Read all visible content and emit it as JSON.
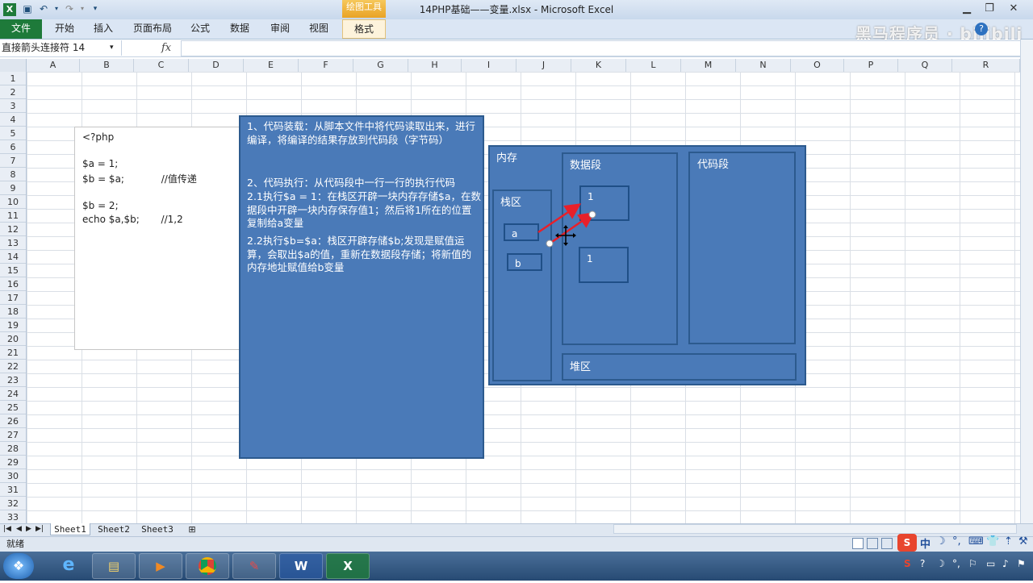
{
  "window": {
    "title": "14PHP基础——变量.xlsx  -  Microsoft Excel",
    "context_tab": "绘图工具",
    "watermark": "黑马程序员 · bilibili"
  },
  "ribbon": {
    "tabs": [
      "开始",
      "插入",
      "页面布局",
      "公式",
      "数据",
      "审阅",
      "视图"
    ],
    "file_tab": "文件",
    "format_tab": "格式"
  },
  "formula_bar": {
    "name_box": "直接箭头连接符 14",
    "fx_label": "fx",
    "value": ""
  },
  "grid": {
    "columns": [
      "A",
      "B",
      "C",
      "D",
      "E",
      "F",
      "G",
      "H",
      "I",
      "J",
      "K",
      "L",
      "M",
      "N",
      "O",
      "P",
      "Q",
      "R"
    ],
    "rows": [
      "1",
      "2",
      "3",
      "4",
      "5",
      "6",
      "7",
      "8",
      "9",
      "10",
      "11",
      "12",
      "13",
      "14",
      "15",
      "16",
      "17",
      "18",
      "19",
      "20",
      "21",
      "22",
      "23",
      "24",
      "25",
      "26",
      "27",
      "28",
      "29",
      "30",
      "31",
      "32",
      "33"
    ]
  },
  "code_box": {
    "lines": [
      "<?php",
      "",
      "$a = 1;",
      "$b = $a;            //值传递",
      "",
      "$b = 2;",
      "echo $a,$b;       //1,2"
    ]
  },
  "note_box": {
    "p1": "1、代码装载：从脚本文件中将代码读取出来，进行编译，将编译的结果存放到代码段（字节码）",
    "p2": "2、代码执行：从代码段中一行一行的执行代码",
    "p3": "2.1执行$a = 1：在栈区开辟一块内存存储$a，在数据段中开辟一块内存保存值1；然后将1所在的位置复制给a变量",
    "p4": "2.2执行$b=$a：栈区开辟存储$b;发现是赋值运算，会取出$a的值，重新在数据段存储；将新值的内存地址赋值给b变量"
  },
  "memory_diagram": {
    "memory_label": "内存",
    "stack_label": "栈区",
    "data_segment_label": "数据段",
    "code_segment_label": "代码段",
    "heap_label": "堆区",
    "var_a": "a",
    "var_b": "b",
    "value_1": "1",
    "value_2": "1",
    "arrow_color": "#e8202a"
  },
  "sheets": {
    "tabs": [
      "Sheet1",
      "Sheet2",
      "Sheet3"
    ],
    "active": "Sheet1"
  },
  "status": {
    "ready": "就绪"
  },
  "colors": {
    "excel_green": "#1e7a3a",
    "shape_blue": "#4a7ab8",
    "shape_border": "#2c5a8e"
  }
}
